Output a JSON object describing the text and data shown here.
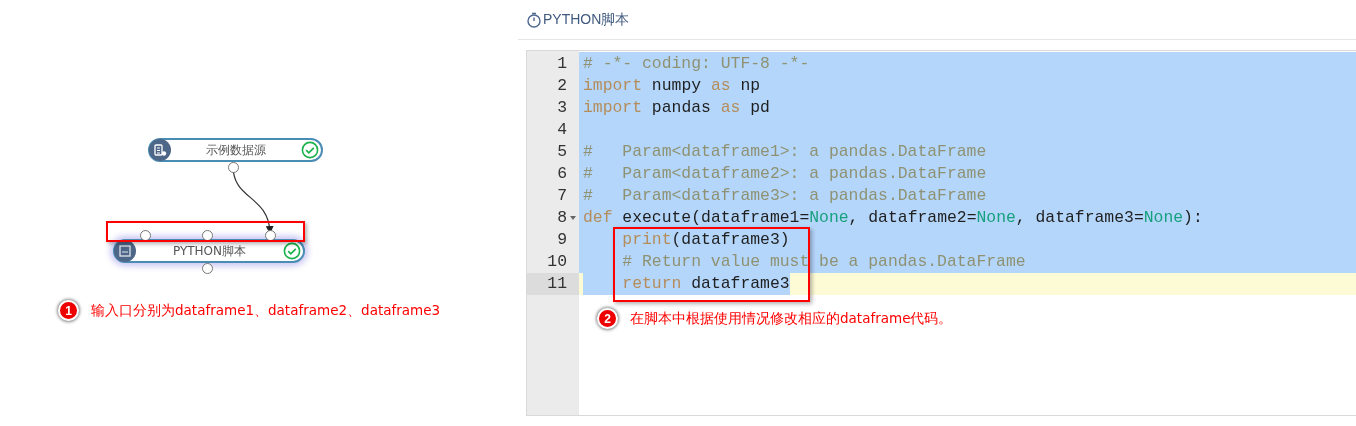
{
  "canvas": {
    "nodes": [
      {
        "label": "示例数据源",
        "kind": "datasource",
        "succeeded": true,
        "selected": false
      },
      {
        "label": "PYTHON脚本",
        "kind": "python",
        "succeeded": true,
        "selected": true
      }
    ]
  },
  "panel": {
    "title": "PYTHON脚本"
  },
  "code": {
    "lines": [
      {
        "number": "1",
        "selected": true,
        "active": false,
        "fold": false,
        "tokens": [
          {
            "kind": "comment",
            "text": "# -*- coding: UTF-8 -*-"
          }
        ]
      },
      {
        "number": "2",
        "selected": true,
        "active": false,
        "fold": false,
        "tokens": [
          {
            "kind": "keyword",
            "text": "import"
          },
          {
            "kind": "plain",
            "text": " numpy "
          },
          {
            "kind": "keyword",
            "text": "as"
          },
          {
            "kind": "plain",
            "text": " np"
          }
        ]
      },
      {
        "number": "3",
        "selected": true,
        "active": false,
        "fold": false,
        "tokens": [
          {
            "kind": "keyword",
            "text": "import"
          },
          {
            "kind": "plain",
            "text": " pandas "
          },
          {
            "kind": "keyword",
            "text": "as"
          },
          {
            "kind": "plain",
            "text": " pd"
          }
        ]
      },
      {
        "number": "4",
        "selected": true,
        "active": false,
        "fold": false
      },
      {
        "number": "5",
        "selected": true,
        "active": false,
        "fold": false,
        "tokens": [
          {
            "kind": "comment",
            "text": "#   Param<dataframe1>: a pandas.DataFrame"
          }
        ]
      },
      {
        "number": "6",
        "selected": true,
        "active": false,
        "fold": false,
        "tokens": [
          {
            "kind": "comment",
            "text": "#   Param<dataframe2>: a pandas.DataFrame"
          }
        ]
      },
      {
        "number": "7",
        "selected": true,
        "active": false,
        "fold": false,
        "tokens": [
          {
            "kind": "comment",
            "text": "#   Param<dataframe3>: a pandas.DataFrame"
          }
        ]
      },
      {
        "number": "8",
        "selected": true,
        "active": false,
        "fold": true,
        "tokens": [
          {
            "kind": "keyword",
            "text": "def"
          },
          {
            "kind": "plain",
            "text": " execute(dataframe1="
          },
          {
            "kind": "constant",
            "text": "None"
          },
          {
            "kind": "plain",
            "text": ", dataframe2="
          },
          {
            "kind": "constant",
            "text": "None"
          },
          {
            "kind": "plain",
            "text": ", dataframe3="
          },
          {
            "kind": "constant",
            "text": "None"
          },
          {
            "kind": "plain",
            "text": "):"
          }
        ]
      },
      {
        "number": "9",
        "selected": true,
        "active": false,
        "fold": false,
        "indented": true,
        "tokens": [
          {
            "kind": "keyword",
            "text": "print"
          },
          {
            "kind": "plain",
            "text": "(dataframe3)"
          }
        ]
      },
      {
        "number": "10",
        "selected": true,
        "active": false,
        "fold": false,
        "indented": true,
        "tokens": [
          {
            "kind": "comment",
            "text": "# Return value must be a pandas.DataFrame"
          }
        ]
      },
      {
        "number": "11",
        "selected": true,
        "active": true,
        "fold": false,
        "indented": true,
        "tokens": [
          {
            "kind": "keyword",
            "text": "return"
          },
          {
            "kind": "plain",
            "text": " dataframe3"
          }
        ]
      }
    ]
  },
  "annotations": [
    {
      "badge": "1",
      "text": "输入口分别为dataframe1、dataframe2、dataframe3"
    },
    {
      "badge": "2",
      "text": "在脚本中根据使用情况修改相应的dataframe代码。"
    }
  ]
}
